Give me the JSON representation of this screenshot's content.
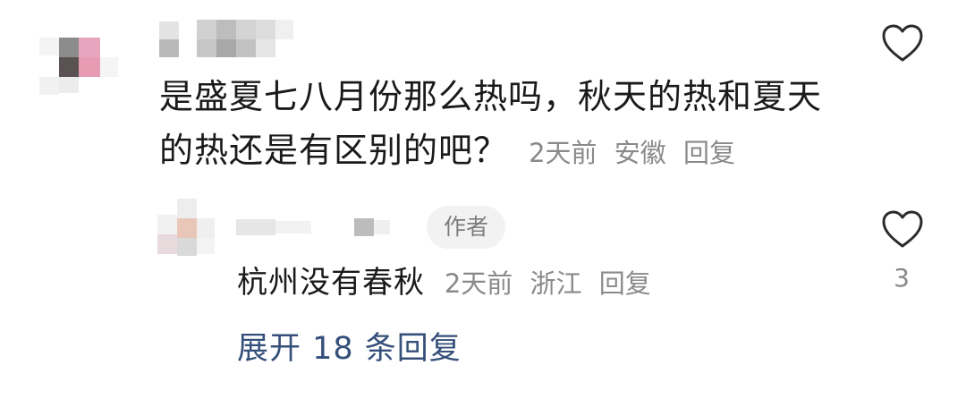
{
  "comment": {
    "text_line1": "是盛夏七八月份那么热吗，秋天的热和夏天",
    "text_line2": "的热还是有区别的吧？",
    "time": "2天前",
    "location": "安徽",
    "reply_label": "回复",
    "like_count": ""
  },
  "reply": {
    "badge": "作者",
    "text": "杭州没有春秋",
    "time": "2天前",
    "location": "浙江",
    "reply_label": "回复",
    "like_count": "3"
  },
  "expand_label": "展开 18 条回复",
  "colors": {
    "text": "#1a1a1a",
    "meta": "#8a8a8a",
    "link": "#35507a",
    "badge_bg": "#f2f2f2"
  }
}
